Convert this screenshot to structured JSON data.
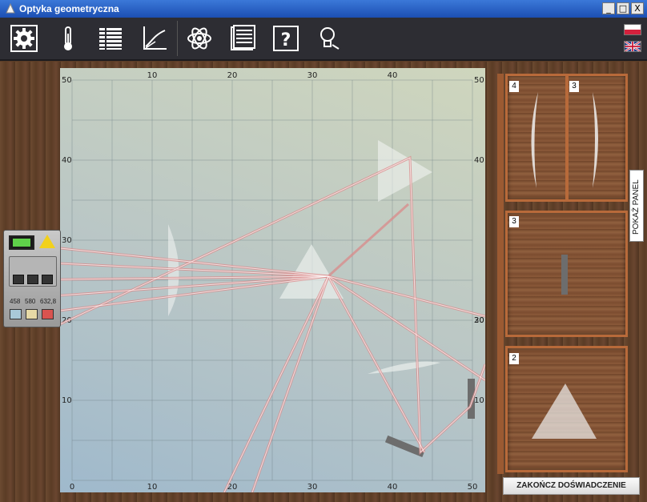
{
  "window": {
    "title": "Optyka geometryczna",
    "buttons": {
      "minimize": "_",
      "maximize": "□",
      "close": "X"
    }
  },
  "toolbar": {
    "tools": [
      {
        "name": "settings-icon"
      },
      {
        "name": "thermometer-icon"
      },
      {
        "name": "table-icon"
      },
      {
        "name": "graph-icon"
      },
      {
        "name": "atom-icon"
      },
      {
        "name": "notebook-icon"
      },
      {
        "name": "help-icon"
      },
      {
        "name": "lightbulb-icon"
      }
    ],
    "languages": [
      "pl",
      "en"
    ]
  },
  "plot": {
    "top_ticks": [
      "10",
      "20",
      "30",
      "40"
    ],
    "bottom_ticks": [
      "0",
      "10",
      "20",
      "30",
      "40",
      "50"
    ],
    "left_ticks": [
      "50",
      "40",
      "30",
      "20",
      "10"
    ],
    "right_ticks": [
      "50",
      "40",
      "30",
      "20",
      "10"
    ]
  },
  "laser": {
    "wavelengths": [
      "458",
      "580",
      "632,8"
    ],
    "wavelength_colors": [
      "#a9c9d8",
      "#e6d9a6",
      "#d9534f"
    ]
  },
  "panel": {
    "box1": {
      "left_count": "4",
      "right_count": "3"
    },
    "box2": {
      "count": "3"
    },
    "box3": {
      "count": "2"
    },
    "show_panel_label": "POKAŻ PANEL",
    "end_button_label": "ZAKOŃCZ DOŚWIADCZENIE"
  }
}
